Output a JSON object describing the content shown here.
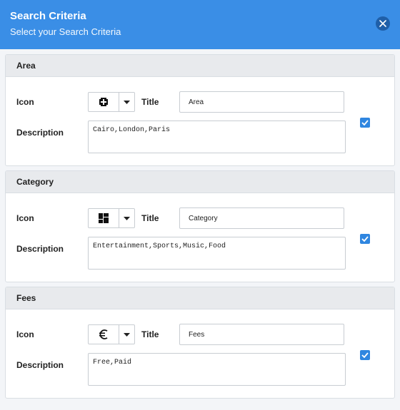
{
  "dialog": {
    "title": "Search Criteria",
    "subtitle": "Select your Search Criteria"
  },
  "criteria": [
    {
      "heading": "Area",
      "icon_label": "Icon",
      "icon_name": "plus-square-icon",
      "title_label": "Title",
      "title_value": "Area",
      "description_label": "Description",
      "description_value": "Cairo,London,Paris",
      "enabled": true
    },
    {
      "heading": "Category",
      "icon_label": "Icon",
      "icon_name": "category-grid-icon",
      "title_label": "Title",
      "title_value": "Category",
      "description_label": "Description",
      "description_value": "Entertainment,Sports,Music,Food",
      "enabled": true
    },
    {
      "heading": "Fees",
      "icon_label": "Icon",
      "icon_name": "euro-icon",
      "title_label": "Title",
      "title_value": "Fees",
      "description_label": "Description",
      "description_value": "Free,Paid",
      "enabled": true
    }
  ],
  "colors": {
    "header": "#3a8ee6",
    "checkbox": "#2f86e0",
    "panel_head": "#e8eaed"
  }
}
